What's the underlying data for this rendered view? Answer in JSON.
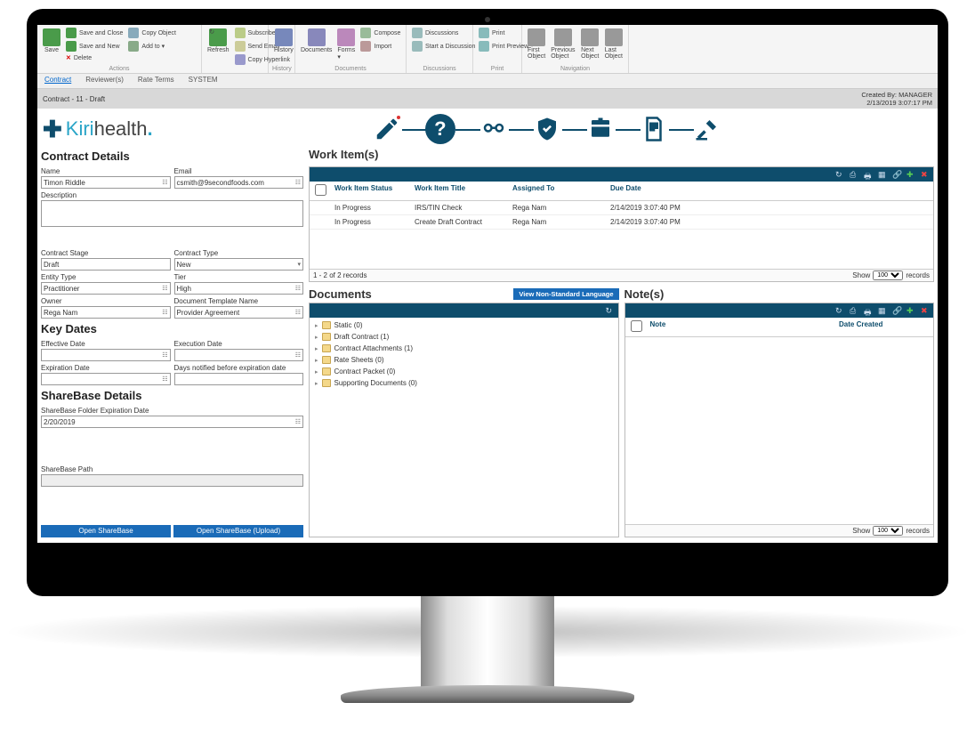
{
  "ribbon": {
    "save": "Save",
    "save_close": "Save and Close",
    "save_new": "Save and New",
    "delete": "Delete",
    "copy_object": "Copy Object",
    "add_to": "Add to ▾",
    "refresh": "Refresh",
    "subscribe": "Subscribe",
    "send_email": "Send Email",
    "copy_hyperlink": "Copy Hyperlink",
    "history": "History",
    "documents": "Documents",
    "forms": "Forms ▾",
    "compose": "Compose",
    "import": "Import",
    "discussions": "Discussions",
    "start_discussion": "Start a Discussion",
    "print": "Print",
    "print_preview": "Print Preview",
    "first": "First Object",
    "previous": "Previous Object",
    "next": "Next Object",
    "last": "Last Object",
    "grp_actions": "Actions",
    "grp_history": "History",
    "grp_documents": "Documents",
    "grp_discussions": "Discussions",
    "grp_print": "Print",
    "grp_navigation": "Navigation"
  },
  "tabs": [
    "Contract",
    "Reviewer(s)",
    "Rate Terms",
    "SYSTEM"
  ],
  "titlebar": {
    "title": "Contract - 11 - Draft",
    "created_by": "Created By: MANAGER",
    "created_on": "2/13/2019 3:07:17 PM"
  },
  "logo": {
    "kiri": "Kiri",
    "health": "health",
    "plus": "✚",
    "dot": "."
  },
  "contract": {
    "title": "Contract Details",
    "name_label": "Name",
    "name": "Timon Riddle",
    "email_label": "Email",
    "email": "csmith@9secondfoods.com",
    "description_label": "Description",
    "description": "",
    "stage_label": "Contract Stage",
    "stage": "Draft",
    "type_label": "Contract Type",
    "type": "New",
    "entity_label": "Entity Type",
    "entity": "Practitioner",
    "tier_label": "Tier",
    "tier": "High",
    "owner_label": "Owner",
    "owner": "Rega Nam",
    "template_label": "Document Template Name",
    "template": "Provider Agreement"
  },
  "keydates": {
    "title": "Key Dates",
    "effective_label": "Effective Date",
    "effective": "",
    "execution_label": "Execution Date",
    "execution": "",
    "expiration_label": "Expiration Date",
    "expiration": "",
    "notify_label": "Days notified before expiration date",
    "notify": ""
  },
  "sharebase": {
    "title": "ShareBase Details",
    "exp_label": "ShareBase Folder Expiration Date",
    "exp": "2/20/2019",
    "path_label": "ShareBase Path",
    "path": "",
    "open": "Open ShareBase",
    "upload": "Open ShareBase (Upload)"
  },
  "workitems": {
    "title": "Work Item(s)",
    "cols": {
      "status": "Work Item Status",
      "title": "Work Item Title",
      "assigned": "Assigned To",
      "due": "Due Date"
    },
    "rows": [
      {
        "status": "In Progress",
        "title": "IRS/TIN Check",
        "assigned": "Rega Nam",
        "due": "2/14/2019 3:07:40 PM"
      },
      {
        "status": "In Progress",
        "title": "Create Draft Contract",
        "assigned": "Rega Nam",
        "due": "2/14/2019 3:07:40 PM"
      }
    ],
    "footer": "1 - 2 of 2 records",
    "show": "Show",
    "records": "records",
    "per": "100"
  },
  "documents": {
    "title": "Documents",
    "view_ns": "View Non-Standard Language",
    "folders": [
      "Static (0)",
      "Draft Contract (1)",
      "Contract Attachments (1)",
      "Rate Sheets (0)",
      "Contract Packet (0)",
      "Supporting Documents (0)"
    ]
  },
  "notes": {
    "title": "Note(s)",
    "cols": {
      "note": "Note",
      "created": "Date Created"
    },
    "show": "Show",
    "records": "records",
    "per": "100"
  }
}
